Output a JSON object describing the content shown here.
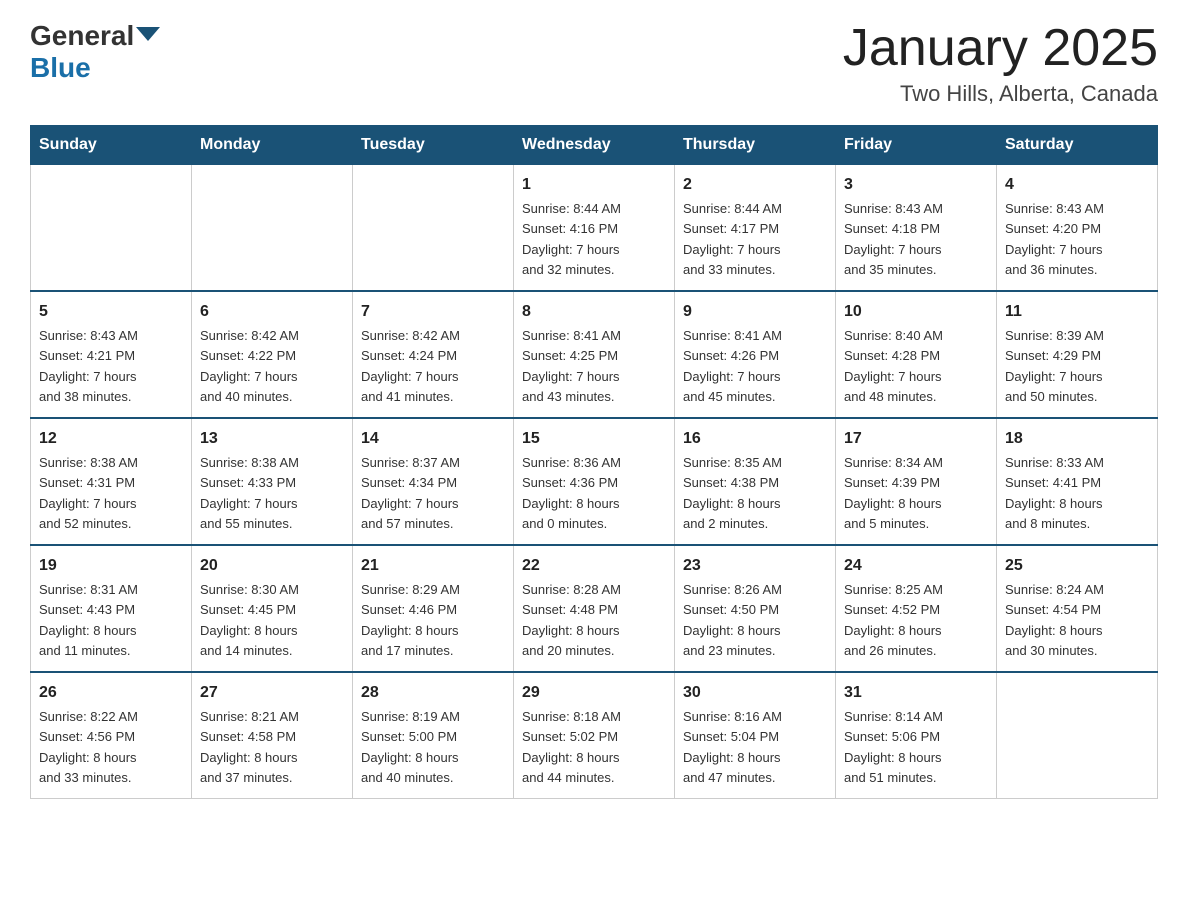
{
  "header": {
    "logo_general": "General",
    "logo_blue": "Blue",
    "title": "January 2025",
    "subtitle": "Two Hills, Alberta, Canada"
  },
  "weekdays": [
    "Sunday",
    "Monday",
    "Tuesday",
    "Wednesday",
    "Thursday",
    "Friday",
    "Saturday"
  ],
  "weeks": [
    [
      {
        "day": "",
        "info": ""
      },
      {
        "day": "",
        "info": ""
      },
      {
        "day": "",
        "info": ""
      },
      {
        "day": "1",
        "info": "Sunrise: 8:44 AM\nSunset: 4:16 PM\nDaylight: 7 hours\nand 32 minutes."
      },
      {
        "day": "2",
        "info": "Sunrise: 8:44 AM\nSunset: 4:17 PM\nDaylight: 7 hours\nand 33 minutes."
      },
      {
        "day": "3",
        "info": "Sunrise: 8:43 AM\nSunset: 4:18 PM\nDaylight: 7 hours\nand 35 minutes."
      },
      {
        "day": "4",
        "info": "Sunrise: 8:43 AM\nSunset: 4:20 PM\nDaylight: 7 hours\nand 36 minutes."
      }
    ],
    [
      {
        "day": "5",
        "info": "Sunrise: 8:43 AM\nSunset: 4:21 PM\nDaylight: 7 hours\nand 38 minutes."
      },
      {
        "day": "6",
        "info": "Sunrise: 8:42 AM\nSunset: 4:22 PM\nDaylight: 7 hours\nand 40 minutes."
      },
      {
        "day": "7",
        "info": "Sunrise: 8:42 AM\nSunset: 4:24 PM\nDaylight: 7 hours\nand 41 minutes."
      },
      {
        "day": "8",
        "info": "Sunrise: 8:41 AM\nSunset: 4:25 PM\nDaylight: 7 hours\nand 43 minutes."
      },
      {
        "day": "9",
        "info": "Sunrise: 8:41 AM\nSunset: 4:26 PM\nDaylight: 7 hours\nand 45 minutes."
      },
      {
        "day": "10",
        "info": "Sunrise: 8:40 AM\nSunset: 4:28 PM\nDaylight: 7 hours\nand 48 minutes."
      },
      {
        "day": "11",
        "info": "Sunrise: 8:39 AM\nSunset: 4:29 PM\nDaylight: 7 hours\nand 50 minutes."
      }
    ],
    [
      {
        "day": "12",
        "info": "Sunrise: 8:38 AM\nSunset: 4:31 PM\nDaylight: 7 hours\nand 52 minutes."
      },
      {
        "day": "13",
        "info": "Sunrise: 8:38 AM\nSunset: 4:33 PM\nDaylight: 7 hours\nand 55 minutes."
      },
      {
        "day": "14",
        "info": "Sunrise: 8:37 AM\nSunset: 4:34 PM\nDaylight: 7 hours\nand 57 minutes."
      },
      {
        "day": "15",
        "info": "Sunrise: 8:36 AM\nSunset: 4:36 PM\nDaylight: 8 hours\nand 0 minutes."
      },
      {
        "day": "16",
        "info": "Sunrise: 8:35 AM\nSunset: 4:38 PM\nDaylight: 8 hours\nand 2 minutes."
      },
      {
        "day": "17",
        "info": "Sunrise: 8:34 AM\nSunset: 4:39 PM\nDaylight: 8 hours\nand 5 minutes."
      },
      {
        "day": "18",
        "info": "Sunrise: 8:33 AM\nSunset: 4:41 PM\nDaylight: 8 hours\nand 8 minutes."
      }
    ],
    [
      {
        "day": "19",
        "info": "Sunrise: 8:31 AM\nSunset: 4:43 PM\nDaylight: 8 hours\nand 11 minutes."
      },
      {
        "day": "20",
        "info": "Sunrise: 8:30 AM\nSunset: 4:45 PM\nDaylight: 8 hours\nand 14 minutes."
      },
      {
        "day": "21",
        "info": "Sunrise: 8:29 AM\nSunset: 4:46 PM\nDaylight: 8 hours\nand 17 minutes."
      },
      {
        "day": "22",
        "info": "Sunrise: 8:28 AM\nSunset: 4:48 PM\nDaylight: 8 hours\nand 20 minutes."
      },
      {
        "day": "23",
        "info": "Sunrise: 8:26 AM\nSunset: 4:50 PM\nDaylight: 8 hours\nand 23 minutes."
      },
      {
        "day": "24",
        "info": "Sunrise: 8:25 AM\nSunset: 4:52 PM\nDaylight: 8 hours\nand 26 minutes."
      },
      {
        "day": "25",
        "info": "Sunrise: 8:24 AM\nSunset: 4:54 PM\nDaylight: 8 hours\nand 30 minutes."
      }
    ],
    [
      {
        "day": "26",
        "info": "Sunrise: 8:22 AM\nSunset: 4:56 PM\nDaylight: 8 hours\nand 33 minutes."
      },
      {
        "day": "27",
        "info": "Sunrise: 8:21 AM\nSunset: 4:58 PM\nDaylight: 8 hours\nand 37 minutes."
      },
      {
        "day": "28",
        "info": "Sunrise: 8:19 AM\nSunset: 5:00 PM\nDaylight: 8 hours\nand 40 minutes."
      },
      {
        "day": "29",
        "info": "Sunrise: 8:18 AM\nSunset: 5:02 PM\nDaylight: 8 hours\nand 44 minutes."
      },
      {
        "day": "30",
        "info": "Sunrise: 8:16 AM\nSunset: 5:04 PM\nDaylight: 8 hours\nand 47 minutes."
      },
      {
        "day": "31",
        "info": "Sunrise: 8:14 AM\nSunset: 5:06 PM\nDaylight: 8 hours\nand 51 minutes."
      },
      {
        "day": "",
        "info": ""
      }
    ]
  ]
}
